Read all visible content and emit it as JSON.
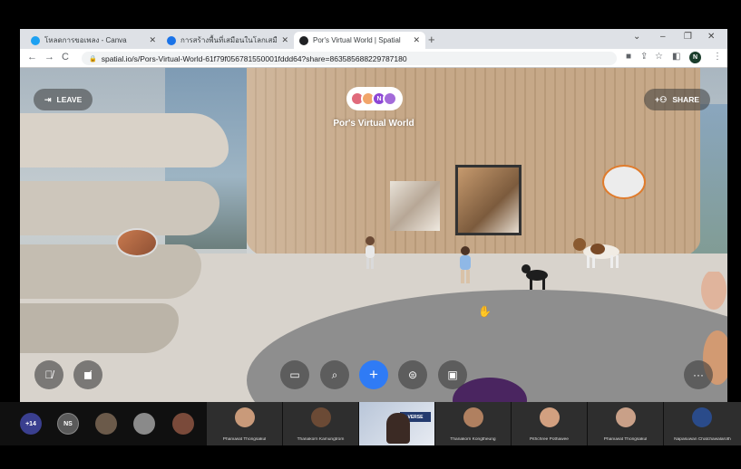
{
  "browser": {
    "tabs": [
      {
        "title": "โหลดการขอเพลง - Canva",
        "favicon_color": "#1da1f2",
        "active": false
      },
      {
        "title": "การสร้างพื้นที่เสมือนในโลกเสมือนจริง",
        "favicon_color": "#1a73e8",
        "active": false
      },
      {
        "title": "Por's Virtual World | Spatial",
        "favicon_color": "#202124",
        "active": true
      }
    ],
    "new_tab_icon": "+",
    "url": "spatial.io/s/Pors-Virtual-World-61f79f056781550001fddd64?share=863585688229787180",
    "profile_initial": "N"
  },
  "spatial": {
    "leave_label": "LEAVE",
    "share_label": "SHARE",
    "world_title": "Por's Virtual World",
    "pill_initial": "N",
    "toolbar_icons": [
      "mic-off-icon",
      "camera-off-icon",
      "content-icon",
      "search-icon",
      "add-icon",
      "emote-icon",
      "share-screen-icon",
      "more-icon"
    ]
  },
  "meeting": {
    "more_count": "+14",
    "self_initials": "NS",
    "participants": [
      {
        "name": "Phanuwat Thongsakul",
        "face_color": "#c99a7a"
      },
      {
        "name": "Thanakorn Kamungtrom",
        "face_color": "#6b4a35"
      },
      {
        "name": "",
        "face_color": "#3b2a24",
        "live": true,
        "banner": "VERSE"
      },
      {
        "name": "Thanakorn Kongtheung",
        "face_color": "#b08060"
      },
      {
        "name": "Pithchree Pothawee",
        "face_color": "#d2a080"
      },
      {
        "name": "Phanuwat Thongsakul",
        "face_color": "#c9a088"
      },
      {
        "name": "Napasuwan Chatchawalaroth",
        "face_color": "#2a4b8a"
      }
    ]
  }
}
